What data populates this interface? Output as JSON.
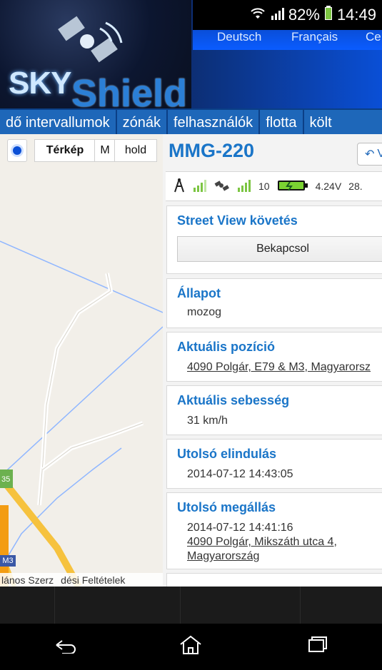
{
  "status": {
    "battery_percent": "82%",
    "time": "14:49"
  },
  "header": {
    "logo_sky": "SKY",
    "logo_shield": "Shield"
  },
  "languages": [
    "Deutsch",
    "Français",
    "Ce"
  ],
  "nav": [
    "dő intervallumok",
    "zónák",
    "felhasználók",
    "flotta",
    "költ"
  ],
  "map": {
    "map_type_label": "Térkép",
    "map_type_m": "M",
    "map_type_hold": "hold",
    "road_label": "35",
    "highway_label": "M3",
    "footer_left": "lános Szerz",
    "footer_right": "dési Feltételek"
  },
  "vehicle": {
    "name": "MMG-220",
    "back_label": "V"
  },
  "telemetry": {
    "gps_count": "10",
    "voltage": "4.24V",
    "extra": "28."
  },
  "cards": {
    "street_view": {
      "title": "Street View követés",
      "button": "Bekapcsol"
    },
    "state": {
      "title": "Állapot",
      "value": "mozog"
    },
    "position": {
      "title": "Aktuális pozíció",
      "value": "4090 Polgár, E79 & M3, Magyarorsz"
    },
    "speed": {
      "title": "Aktuális sebesség",
      "value": "31 km/h"
    },
    "last_start": {
      "title": "Utolsó elindulás",
      "value": "2014-07-12 14:43:05"
    },
    "last_stop": {
      "title": "Utolsó megállás",
      "time": "2014-07-12 14:41:16",
      "address_line1": "4090 Polgár, Mikszáth utca 4,",
      "address_line2": "Magyarország"
    }
  }
}
